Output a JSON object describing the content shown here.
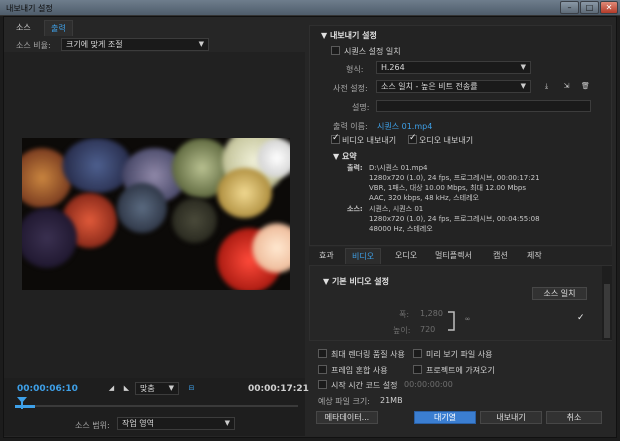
{
  "window": {
    "title": "내보내기 설정"
  },
  "left": {
    "tabs": [
      "소스",
      "출력"
    ],
    "active_tab": 1,
    "scale_label": "소스 비율:",
    "scale_value": "크기에 맞게 조절",
    "timecode_in": "00:00:06:10",
    "timecode_out": "00:00:17:21",
    "fit_value": "맞춤",
    "source_range_label": "소스 범위:",
    "source_range_value": "작업 영역"
  },
  "export": {
    "section_title": "내보내기 설정",
    "match_sequence_label": "시퀀스 설정 일치",
    "format_label": "형식:",
    "format_value": "H.264",
    "preset_label": "사전 설정:",
    "preset_value": "소스 일치 - 높은 비트 전송률",
    "comments_label": "설명:",
    "output_name_label": "출력 이름:",
    "output_name_value": "시퀀스 01.mp4",
    "export_video_label": "비디오 내보내기",
    "export_audio_label": "오디오 내보내기",
    "summary_title": "요약",
    "output_label": "출력:",
    "output_lines": [
      "D:\\시퀀스 01.mp4",
      "1280x720 (1.0), 24 fps, 프로그레시브, 00:00:17:21",
      "VBR, 1패스, 대상 10.00 Mbps, 최대 12.00 Mbps",
      "AAC, 320 kbps, 48 kHz, 스테레오"
    ],
    "source_label": "소스:",
    "source_lines": [
      "시퀀스, 시퀀스 01",
      "1280x720 (1.0), 24 fps, 프로그레시브, 00:04:55:08",
      "48000 Hz, 스테레오"
    ]
  },
  "tabs_right": [
    "효과",
    "비디오",
    "오디오",
    "멀티플렉서",
    "캡션",
    "제작"
  ],
  "video": {
    "section_title": "기본 비디오 설정",
    "match_source_button": "소스 일치",
    "width_label": "폭:",
    "width_value": "1,280",
    "height_label": "높이:",
    "height_value": "720"
  },
  "options": {
    "max_render_quality": "최대 렌더링 품질 사용",
    "use_previews": "미리 보기 파일 사용",
    "frame_blending": "프레임 혼합 사용",
    "import_into_project": "프로젝트에 가져오기",
    "set_start_timecode": "시작 시간 코드 설정",
    "start_timecode_value": "00:00:00:00",
    "file_size_label": "예상 파일 크기:",
    "file_size_value": "21MB",
    "metadata_button": "메타데이터...",
    "queue_button": "대기열",
    "export_button": "내보내기",
    "cancel_button": "취소"
  }
}
